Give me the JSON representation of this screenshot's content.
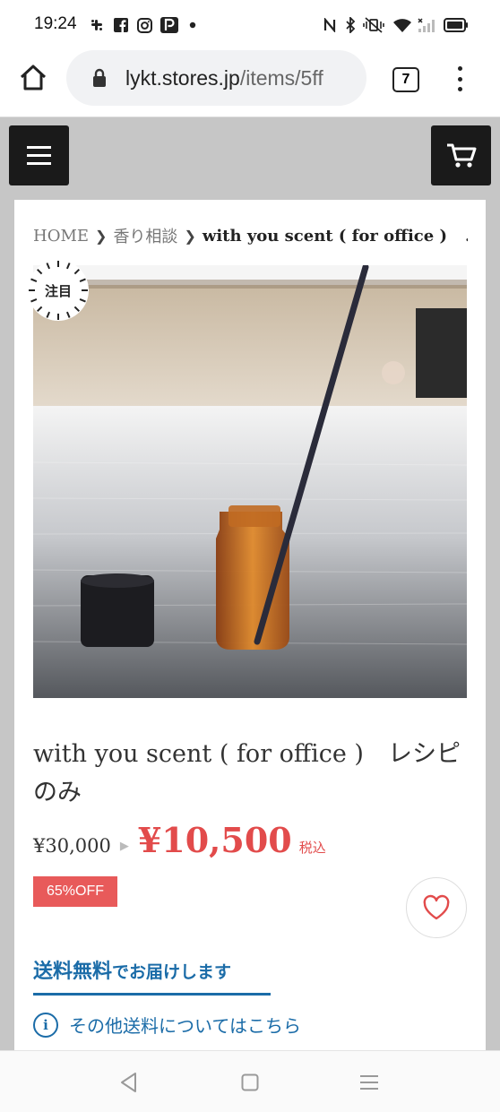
{
  "status_bar": {
    "time": "19:24",
    "left_icons": [
      "slack-icon",
      "facebook-icon",
      "instagram-icon",
      "paypay-icon",
      "dot-icon"
    ],
    "right_icons": [
      "nfc-icon",
      "bluetooth-icon",
      "vibrate-icon",
      "wifi-icon",
      "signal-icon",
      "battery-icon"
    ]
  },
  "browser": {
    "url_host": "lykt.stores.jp",
    "url_rest": "/items/5ff",
    "tab_count": "7"
  },
  "breadcrumb": {
    "home": "HOME",
    "category": "香り相談",
    "current": "with you scent ( for office )",
    "ellipsis": "..."
  },
  "badge": {
    "label": "注目"
  },
  "product": {
    "title": "with you scent ( for office )　レシピのみ",
    "old_price": "¥30,000",
    "arrow": "▶",
    "price": "¥10,500",
    "tax_label": "税込",
    "discount": "65%OFF"
  },
  "shipping": {
    "free_label": "送料無料",
    "rest_label": "でお届けします",
    "info_link": "その他送料についてはこちら",
    "info_icon_glyph": "i"
  },
  "colors": {
    "price_red": "#e24b4b",
    "discount_red": "#e85a5a",
    "link_blue": "#1b6ca8",
    "header_dark": "#1a1a1a"
  }
}
